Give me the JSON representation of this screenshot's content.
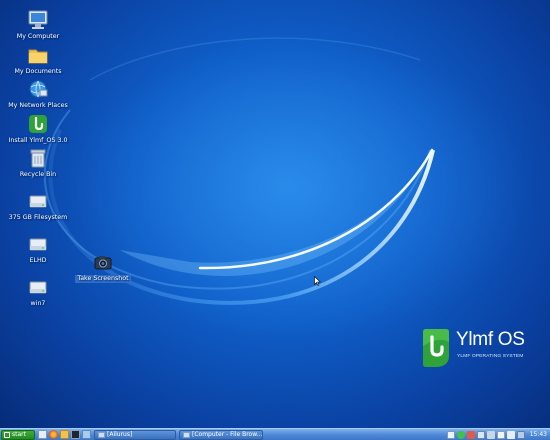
{
  "desktop": {
    "icons": [
      {
        "label": "My Computer",
        "icon": "computer-icon"
      },
      {
        "label": "My Documents",
        "icon": "folder-icon"
      },
      {
        "label": "My Network Places",
        "icon": "network-globe-icon"
      },
      {
        "label": "Install Ylmf_OS 3.0",
        "icon": "installer-icon"
      },
      {
        "label": "Recycle Bin",
        "icon": "recycle-bin-icon"
      },
      {
        "label": "375 GB Filesystem",
        "icon": "drive-icon"
      },
      {
        "label": "ELHD",
        "icon": "drive-icon"
      },
      {
        "label": "win7",
        "icon": "drive-icon"
      },
      {
        "label": "Take Screenshot",
        "icon": "camera-icon"
      }
    ]
  },
  "brand": {
    "name": "Ylmf OS",
    "tagline": "YLMF OPERATING SYSTEM",
    "color": "#2fa33a"
  },
  "taskbar": {
    "start_label": "start",
    "quick_launch": [
      "home-icon",
      "firefox-icon",
      "folder-icon",
      "terminal-icon",
      "show-desktop-icon"
    ],
    "tasks": [
      {
        "label": "[Ailurus]",
        "icon": "window-icon"
      },
      {
        "label": "[Computer - File Brow...",
        "icon": "window-icon"
      }
    ],
    "tray_icons": [
      "pencil-icon",
      "chat-icon",
      "update-icon",
      "network-icon",
      "keyboard-icon",
      "mail-icon",
      "volume-icon",
      "display-icon"
    ],
    "clock": "15:43"
  },
  "colors": {
    "desktop_blue": "#0f5ec8",
    "taskbar_blue": "#4f8ad8",
    "start_green": "#228a23"
  }
}
